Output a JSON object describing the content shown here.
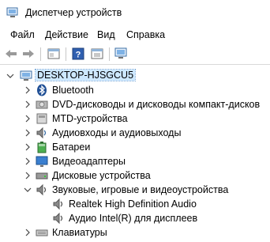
{
  "window": {
    "title": "Диспетчер устройств"
  },
  "menu": [
    "Файл",
    "Действие",
    "Вид",
    "Справка"
  ],
  "toolbar": {
    "buttons": [
      "back-arrow-icon",
      "forward-arrow-icon",
      "properties-icon",
      "help-icon",
      "update-driver-icon",
      "scan-hardware-icon"
    ]
  },
  "tree": {
    "root": "DESKTOP-HJSGCU5",
    "categories": [
      {
        "label": "Bluetooth",
        "icon": "bluetooth-icon",
        "expanded": false
      },
      {
        "label": "DVD-дисководы и дисководы компакт-дисков",
        "icon": "dvd-drive-icon",
        "expanded": false
      },
      {
        "label": "MTD-устройства",
        "icon": "mtd-device-icon",
        "expanded": false
      },
      {
        "label": "Аудиовходы и аудиовыходы",
        "icon": "audio-io-icon",
        "expanded": false
      },
      {
        "label": "Батареи",
        "icon": "battery-icon",
        "expanded": false
      },
      {
        "label": "Видеоадаптеры",
        "icon": "display-adapter-icon",
        "expanded": false
      },
      {
        "label": "Дисковые устройства",
        "icon": "disk-drive-icon",
        "expanded": false
      },
      {
        "label": "Звуковые, игровые и видеоустройства",
        "icon": "sound-device-icon",
        "expanded": true,
        "children": [
          "Realtek High Definition Audio",
          "Аудио Intel(R) для дисплеев"
        ]
      },
      {
        "label": "Клавиатуры",
        "icon": "keyboard-icon",
        "expanded": false
      }
    ]
  }
}
